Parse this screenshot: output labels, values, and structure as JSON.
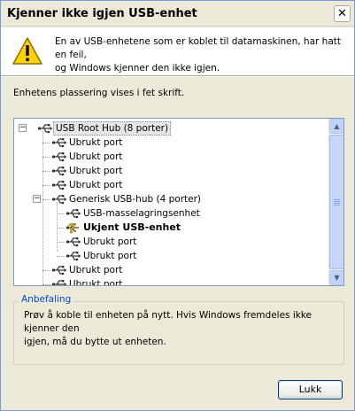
{
  "window": {
    "title": "Kjenner ikke igjen USB-enhet",
    "close_label": "✕"
  },
  "header": {
    "icon": "warning-icon",
    "message": "En av USB-enhetene som er koblet til datamaskinen, har hatt en feil,\nog Windows kjenner den ikke igjen."
  },
  "location_text": "Enhetens plassering vises i fet skrift.",
  "tree": {
    "items": [
      {
        "label": "USB Root Hub (8 porter)",
        "icon": "usb-hub-icon",
        "expander": "⊟",
        "bold": false,
        "selected": true
      },
      {
        "label": "Ubrukt port",
        "icon": "usb-port-icon"
      },
      {
        "label": "Ubrukt port",
        "icon": "usb-port-icon"
      },
      {
        "label": "Ubrukt port",
        "icon": "usb-port-icon"
      },
      {
        "label": "Ubrukt port",
        "icon": "usb-port-icon"
      },
      {
        "label": "Generisk USB-hub (4 porter)",
        "icon": "usb-hub-icon",
        "expander": "⊟"
      },
      {
        "label": "USB-masselagringsenhet",
        "icon": "usb-device-icon"
      },
      {
        "label": "Ukjent USB-enhet",
        "icon": "unknown-device-icon",
        "bold": true
      },
      {
        "label": "Ubrukt port",
        "icon": "usb-port-icon"
      },
      {
        "label": "Ubrukt port",
        "icon": "usb-port-icon"
      },
      {
        "label": "Ubrukt port",
        "icon": "usb-port-icon"
      },
      {
        "label": "Ubrukt port",
        "icon": "usb-port-icon"
      }
    ]
  },
  "recommendation": {
    "title": "Anbefaling",
    "text": "Prøv å koble til enheten på nytt. Hvis Windows fremdeles ikke kjenner den\nigjen, må du bytte ut enheten."
  },
  "ok_button": "Lukk",
  "colors": {
    "title_accent": "#0046D5",
    "warning_yellow": "#FFD200"
  }
}
